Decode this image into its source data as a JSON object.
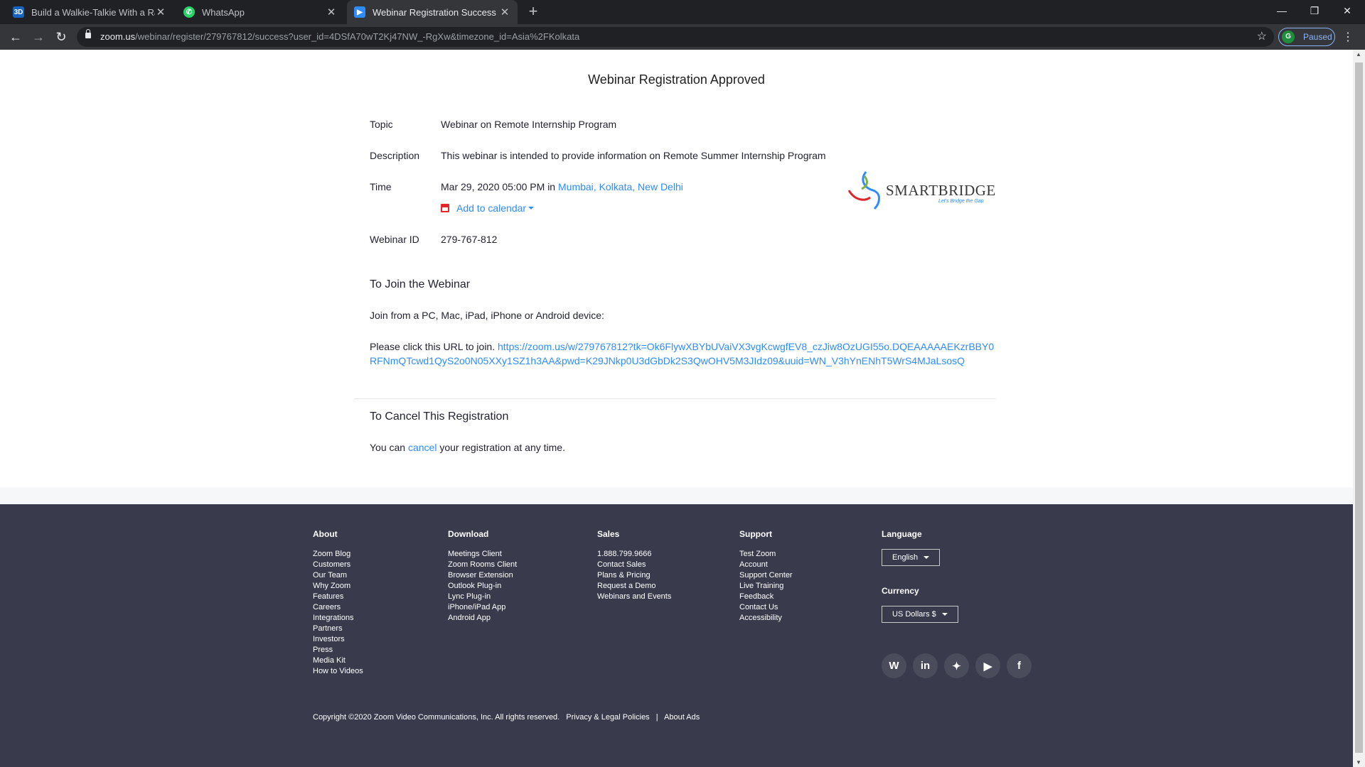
{
  "browser": {
    "tabs": [
      {
        "title": "Build a Walkie-Talkie With a Rasp",
        "favicon": "3D",
        "favicon_color": "#1565c0",
        "active": false
      },
      {
        "title": "WhatsApp",
        "favicon": "whatsapp-icon",
        "favicon_color": "#25d366",
        "active": false
      },
      {
        "title": "Webinar Registration Success - Z",
        "favicon": "zoom-icon",
        "favicon_color": "#2d8cff",
        "active": true
      }
    ],
    "url_domain": "zoom.us",
    "url_path": "/webinar/register/279767812/success?user_id=4DSfA70wT2Kj47NW_-RgXw&timezone_id=Asia%2FKolkata",
    "profile_initial": "G",
    "profile_status": "Paused"
  },
  "page": {
    "heading": "Webinar Registration Approved",
    "topic_label": "Topic",
    "topic_value": "Webinar on Remote Internship Program",
    "description_label": "Description",
    "description_value": "This webinar is intended to provide information on Remote Summer Internship Program",
    "time_label": "Time",
    "time_value": "Mar 29, 2020 05:00 PM in",
    "time_zone_link": "Mumbai, Kolkata, New Delhi",
    "add_to_calendar": "Add to calendar",
    "webinar_id_label": "Webinar ID",
    "webinar_id_value": "279-767-812",
    "logo_text": "SMARTBRIDGE",
    "logo_tagline": "Let's Bridge the Gap",
    "join_heading": "To Join the Webinar",
    "join_device_text": "Join from a PC, Mac, iPad, iPhone or Android device:",
    "join_url_prefix": "Please click this URL to join.",
    "join_url": "https://zoom.us/w/279767812?tk=Ok6FlywXBYbUVaiVX3vgKcwgfEV8_czJiw8OzUGI55o.DQEAAAAAEKzrBBY0RFNmQTcwd1QyS2o0N05XXy1SZ1h3AA&pwd=K29JNkp0U3dGbDk2S3QwOHV5M3JIdz09&uuid=WN_V3hYnENhT5WrS4MJaLsosQ",
    "cancel_heading": "To Cancel This Registration",
    "cancel_prefix": "You can",
    "cancel_link": "cancel",
    "cancel_suffix": "your registration at any time."
  },
  "footer": {
    "about": {
      "title": "About",
      "items": [
        "Zoom Blog",
        "Customers",
        "Our Team",
        "Why Zoom",
        "Features",
        "Careers",
        "Integrations",
        "Partners",
        "Investors",
        "Press",
        "Media Kit",
        "How to Videos"
      ]
    },
    "download": {
      "title": "Download",
      "items": [
        "Meetings Client",
        "Zoom Rooms Client",
        "Browser Extension",
        "Outlook Plug-in",
        "Lync Plug-in",
        "iPhone/iPad App",
        "Android App"
      ]
    },
    "sales": {
      "title": "Sales",
      "items": [
        "1.888.799.9666",
        "Contact Sales",
        "Plans & Pricing",
        "Request a Demo",
        "Webinars and Events"
      ]
    },
    "support": {
      "title": "Support",
      "items": [
        "Test Zoom",
        "Account",
        "Support Center",
        "Live Training",
        "Feedback",
        "Contact Us",
        "Accessibility"
      ]
    },
    "language_title": "Language",
    "language_value": "English",
    "currency_title": "Currency",
    "currency_value": "US Dollars $",
    "social": [
      "wordpress-icon",
      "linkedin-icon",
      "twitter-icon",
      "youtube-icon",
      "facebook-icon"
    ],
    "copyright": "Copyright ©2020 Zoom Video Communications, Inc. All rights reserved.",
    "privacy": "Privacy & Legal Policies",
    "separator": "|",
    "about_ads": "About Ads"
  }
}
